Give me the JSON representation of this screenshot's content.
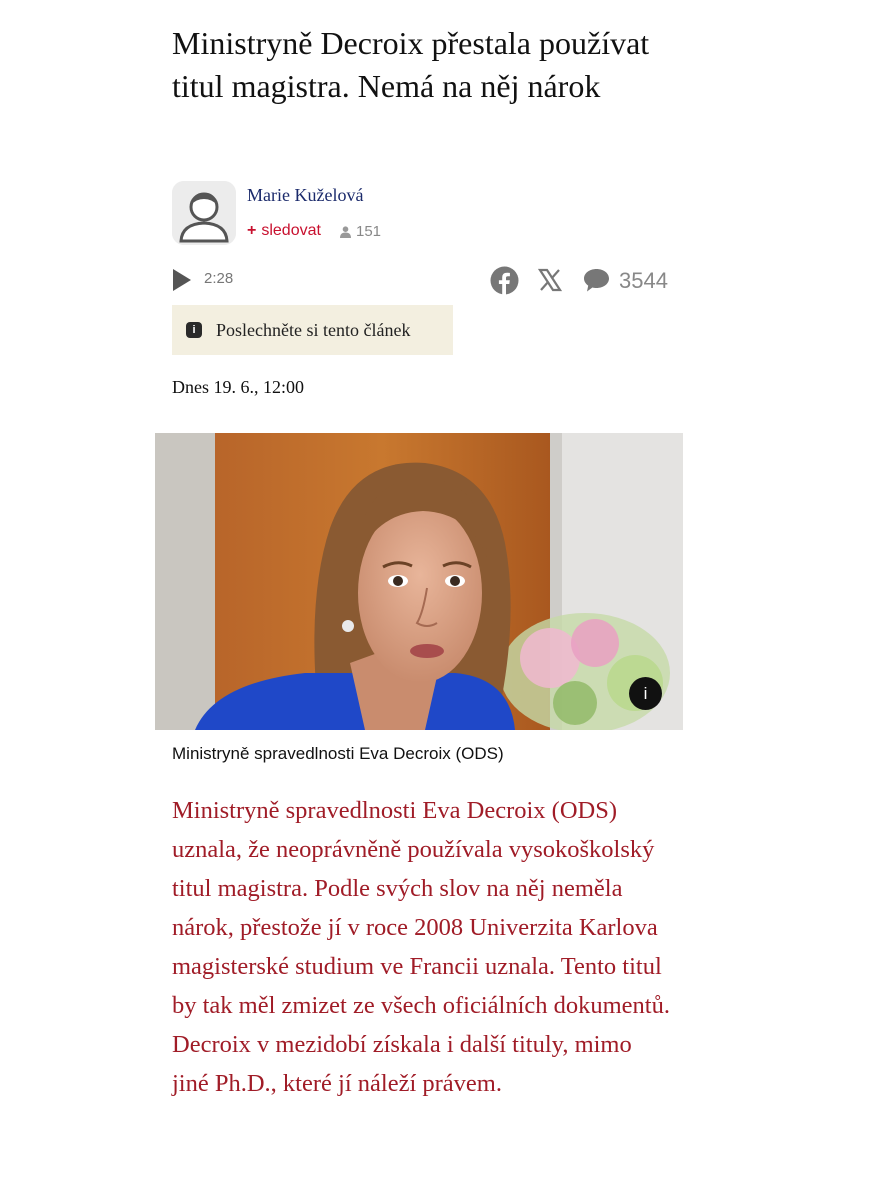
{
  "article": {
    "headline": "Ministryně Decroix přestala používat titul magistra. Nemá na něj nárok",
    "date": "Dnes 19. 6., 12:00",
    "perex": "Ministryně spravedlnosti Eva Decroix (ODS) uznala, že neoprávněně používala vysokoškolský titul magistra. Podle svých slov na něj neměla nárok, přestože jí v roce 2008 Univerzita Karlova magisterské studium ve Francii uznala. Tento titul by tak měl zmizet ze všech oficiálních dokumentů. Decroix v mezidobí získala i další tituly, mimo jiné Ph.D., které jí náleží právem."
  },
  "author": {
    "name": "Marie Kuželová",
    "follow_label": "sledovat",
    "follow_plus": "+",
    "followers": "151"
  },
  "audio": {
    "duration": "2:28",
    "listen_label": "Poslechněte si tento článek",
    "listen_icon_glyph": "i"
  },
  "share": {
    "comments": "3544",
    "icons": [
      "facebook-icon",
      "x-icon",
      "comment-icon"
    ]
  },
  "photo": {
    "caption": "Ministryně spravedlnosti Eva Decroix (ODS)",
    "info_glyph": "i"
  },
  "colors": {
    "perex": "#a01c27",
    "follow": "#c8102e",
    "author": "#1b2a6b",
    "listen_bg": "#f3efe0"
  }
}
